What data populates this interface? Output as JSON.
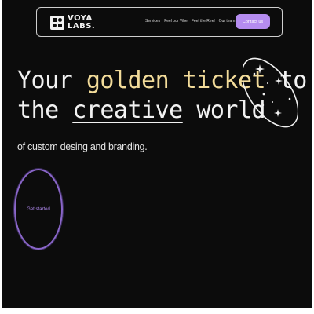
{
  "header": {
    "logo_line1": "VOYA",
    "logo_line2": "LABS.",
    "nav_items": [
      "Services",
      "Feel our Vibe",
      "Feel the Reel",
      "Our team"
    ],
    "contact_label": "Contact us"
  },
  "hero": {
    "line1_word1": "Your",
    "line1_highlight": "golden ticket",
    "line1_word2": "to",
    "line2_word1": "the",
    "line2_underlined": "creative",
    "line2_word2": "world",
    "subtitle": "of custom desing and branding.",
    "cta_label": "Get started"
  },
  "colors": {
    "background": "#0c0c0c",
    "accent_purple": "#b58cf0",
    "gold": "#f3dc9a",
    "text": "#f2f2f2"
  },
  "icons": {
    "logo": "voya-logo-icon",
    "decoration": "star-orb-icon"
  }
}
